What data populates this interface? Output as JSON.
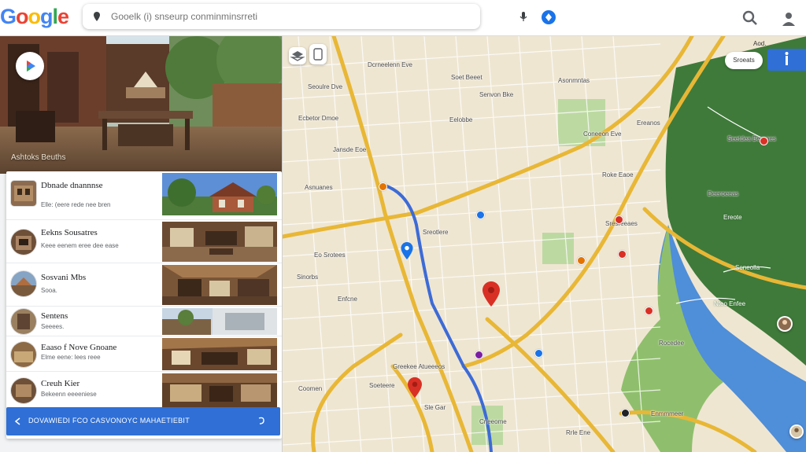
{
  "brand": {
    "name": "Google"
  },
  "search": {
    "placeholder": "Gooelk (i) snseurp conminminsrreti"
  },
  "hero": {
    "caption": "Ashtoks Beuths"
  },
  "list": [
    {
      "title": "Dbnade dnannnse",
      "subtitle": "Elle: (eere rede nee bren"
    },
    {
      "title": "Eekns Sousatres",
      "subtitle": "Keee eenem eree dee ease"
    },
    {
      "title": "Sosvani Mbs",
      "subtitle": "Sooa."
    },
    {
      "title": "Sentens",
      "subtitle": "Seeees."
    },
    {
      "title": "Eaaso f Nove Gnoane",
      "subtitle": "Elme eene: lees reee"
    },
    {
      "title": "Creuh Kier",
      "subtitle": "Bekeenn eeeeniese"
    }
  ],
  "cta": {
    "label": "DOVAWIEDI FCO CASVONOYC MAHAETIEBIT"
  },
  "map": {
    "chip_label": "Sroeats",
    "corner_label": "Aod.",
    "labels": [
      {
        "text": "Dcrneelenn Eve"
      },
      {
        "text": "Soet Beeet"
      },
      {
        "text": "Seoulre Dve"
      },
      {
        "text": "Asonmntas"
      },
      {
        "text": "Senvon Bke"
      },
      {
        "text": "Ecbetor Dmoe"
      },
      {
        "text": "Eelobbe"
      },
      {
        "text": "Ereanos"
      },
      {
        "text": "Coneeon Eve"
      },
      {
        "text": "Jansde Eoe"
      },
      {
        "text": "Roke Eaoe"
      },
      {
        "text": "Seetdea Berpaes"
      },
      {
        "text": "Asnuanes"
      },
      {
        "text": "Deeroeeas"
      },
      {
        "text": "Ereote"
      },
      {
        "text": "Sresreeaes"
      },
      {
        "text": "Sreotlere"
      },
      {
        "text": "Eo Srotees"
      },
      {
        "text": "Sinorbs"
      },
      {
        "text": "Enfcne"
      },
      {
        "text": "Soneolla"
      },
      {
        "text": "Nteo Enfee"
      },
      {
        "text": "Rocedee"
      },
      {
        "text": "Greekee Atueeeos"
      },
      {
        "text": "Soeteere"
      },
      {
        "text": "Coomen"
      },
      {
        "text": "Sle Gar"
      },
      {
        "text": "Enmmmeer"
      },
      {
        "text": "Cneeome"
      },
      {
        "text": "Rrle Ene"
      }
    ]
  },
  "colors": {
    "accent": "#1a73e8",
    "cta": "#2f6fd6",
    "road": "#e8b735",
    "route": "#3d6bd6",
    "park": "#3f7a3a",
    "water": "#4f8ed8",
    "pin": "#d93025"
  },
  "icons": {
    "search": "magnifier-icon",
    "account": "person-icon",
    "layers": "layers-icon",
    "pin": "map-pin-icon"
  }
}
